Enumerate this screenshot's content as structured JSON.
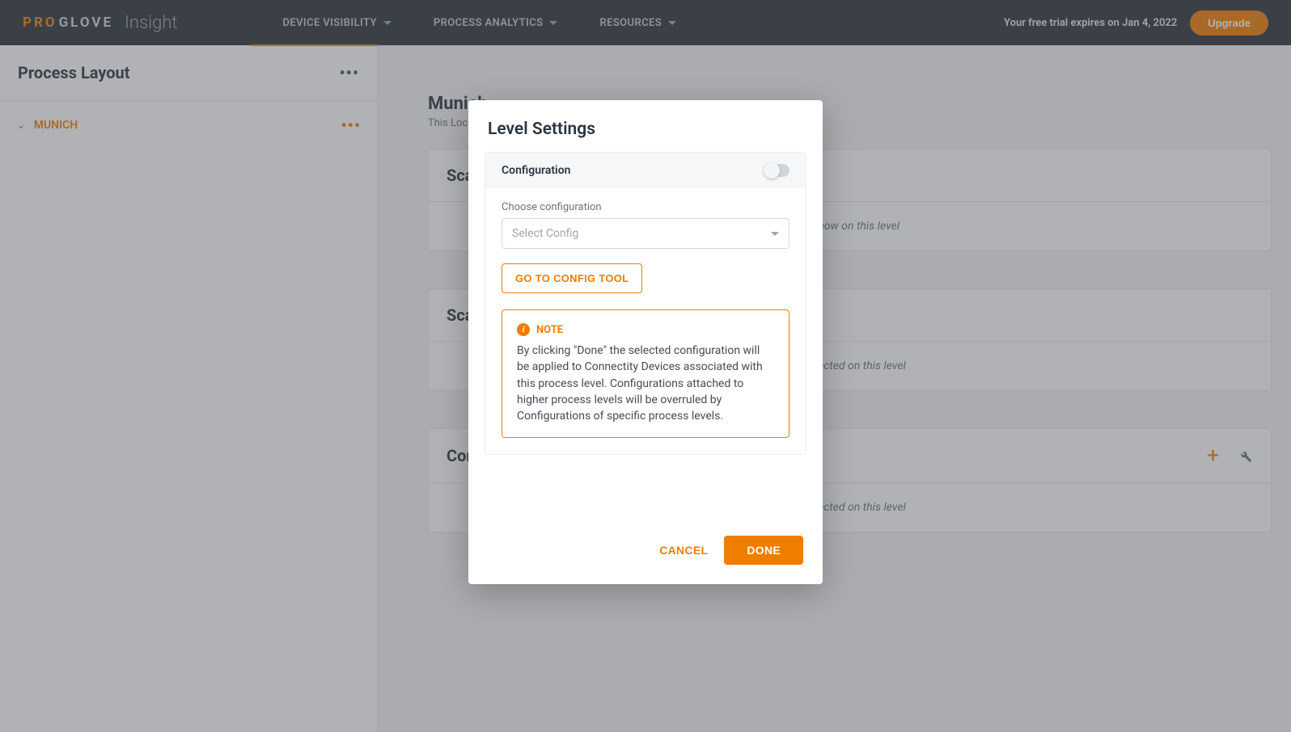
{
  "brand": {
    "pro": "PRO",
    "glove": "GLOVE",
    "insight": "Insight"
  },
  "nav": {
    "items": [
      "DEVICE VISIBILITY",
      "PROCESS ANALYTICS",
      "RESOURCES"
    ],
    "trial_text": "Your free trial expires on Jan 4, 2022",
    "upgrade": "Upgrade"
  },
  "sidebar": {
    "title": "Process Layout",
    "tree": {
      "item": "MUNICH"
    }
  },
  "main": {
    "level": {
      "title": "Munich",
      "subtitle": "This Location"
    },
    "cards": [
      {
        "title": "Scanner",
        "empty": "to show on this level"
      },
      {
        "title": "Scanner",
        "empty": "connected on this level"
      },
      {
        "title": "Connect",
        "empty": "connected on this level"
      }
    ]
  },
  "modal": {
    "title": "Level Settings",
    "config": {
      "header": "Configuration",
      "choose_label": "Choose configuration",
      "select_placeholder": "Select Config",
      "tool_button": "GO TO CONFIG TOOL",
      "note_label": "NOTE",
      "note_text": "By clicking \"Done\" the selected configuration will be applied to Connectity Devices associated with this process level. Configurations attached to higher process levels will be overruled by Configurations of specific process levels."
    },
    "actions": {
      "cancel": "CANCEL",
      "done": "DONE"
    }
  }
}
